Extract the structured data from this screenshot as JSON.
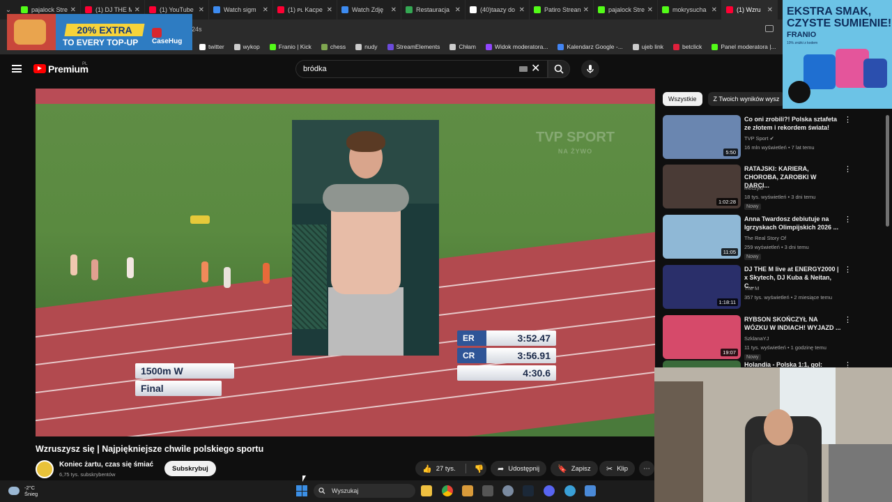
{
  "browser": {
    "tabs": [
      {
        "title": "pajalock Stre",
        "color": "#53fc18"
      },
      {
        "title": "(1) DJ THE M",
        "color": "#ff0033"
      },
      {
        "title": "(1) YouTube",
        "color": "#ff0033"
      },
      {
        "title": "Watch sigm",
        "color": "#3d8bf0"
      },
      {
        "title": "(1) ᴘʟ Kacpe",
        "color": "#ff0033"
      },
      {
        "title": "Watch Zdję",
        "color": "#3d8bf0"
      },
      {
        "title": "Restauracja",
        "color": "#34a853"
      },
      {
        "title": "(40)taazy do",
        "color": "#ffffff"
      },
      {
        "title": "Patiro Strean",
        "color": "#53fc18"
      },
      {
        "title": "pajalock Stre",
        "color": "#53fc18"
      },
      {
        "title": "mokrysucha",
        "color": "#53fc18"
      },
      {
        "title": "(1) Wzru",
        "color": "#ff0033",
        "active": true
      }
    ],
    "address_fragment": "24s",
    "bookmarks": [
      {
        "label": "twitter",
        "color": "#ffffff"
      },
      {
        "label": "wykop",
        "color": "#cccccc"
      },
      {
        "label": "Franio | Kick",
        "color": "#53fc18"
      },
      {
        "label": "chess",
        "color": "#7fa650"
      },
      {
        "label": "nudy",
        "color": "#cccccc"
      },
      {
        "label": "StreamElements",
        "color": "#6c4bdc"
      },
      {
        "label": "Chłam",
        "color": "#cccccc"
      },
      {
        "label": "Widok moderatora...",
        "color": "#9146ff"
      },
      {
        "label": "Kalendarz Google -...",
        "color": "#4285f4"
      },
      {
        "label": "ujeb link",
        "color": "#cccccc"
      },
      {
        "label": "betclick",
        "color": "#e0203c"
      },
      {
        "label": "Panel moderatora |...",
        "color": "#53fc18"
      }
    ]
  },
  "ads": {
    "top_left": {
      "badge": "20% EXTRA",
      "line2": "TO EVERY TOP-UP",
      "brand": "CaseHug"
    },
    "top_right": {
      "line1": "EKSTRA SMAK,",
      "line1b": "CZYSTE SUMIENIE!",
      "brand": "FRANIO",
      "small": "10% zniżki z kodem"
    }
  },
  "youtube": {
    "premium_label": "Premium",
    "premium_region": "PL",
    "search_query": "bródka",
    "video": {
      "title": "Wzruszysz się | Najpiękniejsze chwile polskiego sportu",
      "channel": "Koniec żartu, czas się śmiać",
      "subscribers": "6,75 tys. subskrybentów",
      "subscribe_label": "Subskrybuj",
      "likes": "27 tys.",
      "share_label": "Udostępnij",
      "save_label": "Zapisz",
      "clip_label": "Klip",
      "watermark": "TVP",
      "watermark_sub": "SPORT",
      "watermark_sub2": "NA ŻYWO",
      "event": "1500m W",
      "round": "Final",
      "records": [
        {
          "k": "ER",
          "v": "3:52.47"
        },
        {
          "k": "CR",
          "v": "3:56.91"
        },
        {
          "k": "",
          "v": "4:30.6"
        }
      ]
    },
    "chips": [
      "Wszystkie",
      "Z Twoich wyników wysz"
    ],
    "recommendations": [
      {
        "title": "Co oni zrobili?! Polska sztafeta ze złotem i rekordem świata!",
        "channel": "TVP Sport ✔",
        "meta": "16 mln wyświetleń • 7 lat temu",
        "duration": "5:50",
        "badge": "",
        "thumb": "#6a86b0"
      },
      {
        "title": "RATAJSKI: KARIERA, CHOROBA, ZAROBKI W DARCI...",
        "channel": "Meczyki",
        "meta": "18 tys. wyświetleń • 3 dni temu",
        "duration": "1:02:28",
        "badge": "Nowy",
        "thumb": "#4a3b36"
      },
      {
        "title": "Anna Twardosz debiutuje na Igrzyskach Olimpijskich 2026 ...",
        "channel": "The Real Story Of",
        "meta": "259 wyświetleń • 3 dni temu",
        "duration": "11:05",
        "badge": "Nowy",
        "thumb": "#8fb8d6"
      },
      {
        "title": "DJ THE M live at ENERGY2000 | x Skytech, DJ Kuba & Neitan, C...",
        "channel": "The M",
        "meta": "357 tys. wyświetleń • 2 miesiące temu",
        "duration": "1:18:11",
        "badge": "",
        "thumb": "#2a2f6a"
      },
      {
        "title": "RYBSON SKOŃCZYŁ NA WÓZKU W INDIACH! WYJAZD ...",
        "channel": "SzklanaYJ",
        "meta": "11 tys. wyświetleń • 1 godzinę temu",
        "duration": "19:07",
        "badge": "Nowy",
        "thumb": "#d64a6a"
      },
      {
        "title": "Holandia - Polska 1:1, gol:",
        "channel": "",
        "meta": "",
        "duration": "",
        "badge": "",
        "thumb": "#3a6a3a"
      }
    ]
  },
  "taskbar": {
    "temp": "-2°C",
    "weather": "Śnieg",
    "search_placeholder": "Wyszukaj"
  }
}
